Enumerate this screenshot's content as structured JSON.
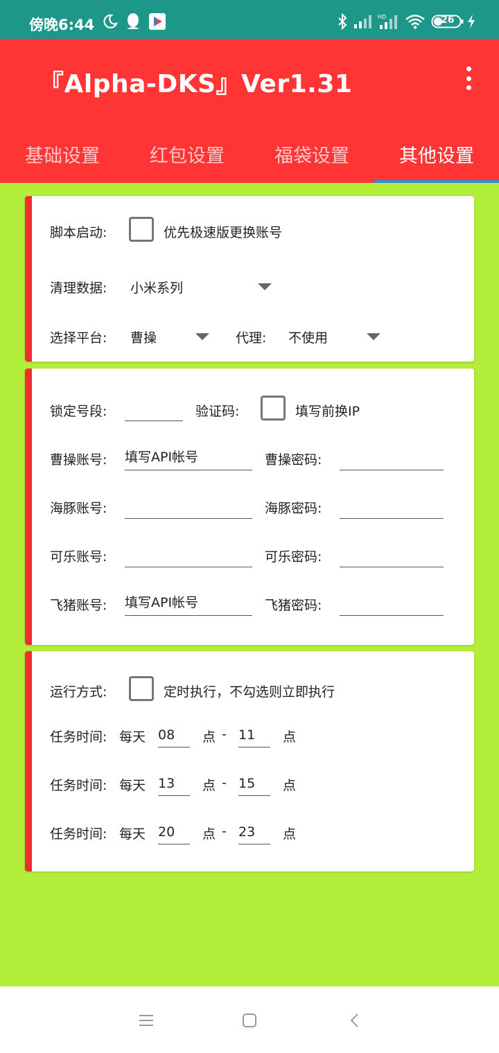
{
  "status_bar": {
    "time": "傍晚6:44",
    "battery": "26",
    "icons": [
      "moon-icon",
      "qq-icon",
      "play-store-icon",
      "bluetooth-icon",
      "signal-icon",
      "hd-signal-icon",
      "wifi-icon",
      "battery-icon",
      "charging-icon"
    ]
  },
  "app_bar": {
    "title": "『Alpha-DKS』Ver1.31",
    "more_icon": "more-vert-icon"
  },
  "tabs": [
    {
      "label": "基础设置",
      "active": false
    },
    {
      "label": "红包设置",
      "active": false
    },
    {
      "label": "福袋设置",
      "active": false
    },
    {
      "label": "其他设置",
      "active": true
    }
  ],
  "card1": {
    "script_start_label": "脚本启动:",
    "script_start_check_label": "优先极速版更换账号",
    "clear_data_label": "清理数据:",
    "clear_data_value": "小米系列",
    "platform_label": "选择平台:",
    "platform_value": "曹操",
    "proxy_label": "代理:",
    "proxy_value": "不使用"
  },
  "card2": {
    "lock_segment_label": "锁定号段:",
    "lock_segment_value": "",
    "captcha_label": "验证码:",
    "captcha_check_label": "填写前换IP",
    "rows": [
      {
        "account_label": "曹操账号:",
        "account_value": "填写API帐号",
        "password_label": "曹操密码:",
        "password_value": ""
      },
      {
        "account_label": "海豚账号:",
        "account_value": "",
        "password_label": "海豚密码:",
        "password_value": ""
      },
      {
        "account_label": "可乐账号:",
        "account_value": "",
        "password_label": "可乐密码:",
        "password_value": ""
      },
      {
        "account_label": "飞猪账号:",
        "account_value": "填写API帐号",
        "password_label": "飞猪密码:",
        "password_value": ""
      }
    ]
  },
  "card3": {
    "run_mode_label": "运行方式:",
    "run_mode_check_label": "定时执行，不勾选则立即执行",
    "tasks": [
      {
        "label": "任务时间:",
        "daily": "每天",
        "start": "08",
        "unit1": "点",
        "dash": "-",
        "end": "11",
        "unit2": "点"
      },
      {
        "label": "任务时间:",
        "daily": "每天",
        "start": "13",
        "unit1": "点",
        "dash": "-",
        "end": "15",
        "unit2": "点"
      },
      {
        "label": "任务时间:",
        "daily": "每天",
        "start": "20",
        "unit1": "点",
        "dash": "-",
        "end": "23",
        "unit2": "点"
      }
    ]
  },
  "nav_bar": {
    "icons": [
      "menu-icon",
      "home-icon",
      "back-icon"
    ]
  },
  "colors": {
    "status_bar": "#1c978a",
    "app_bar": "#ff3535",
    "background": "#b2ee3a",
    "card_accent": "#ef2f2f",
    "tab_indicator": "#2f8fd6"
  }
}
